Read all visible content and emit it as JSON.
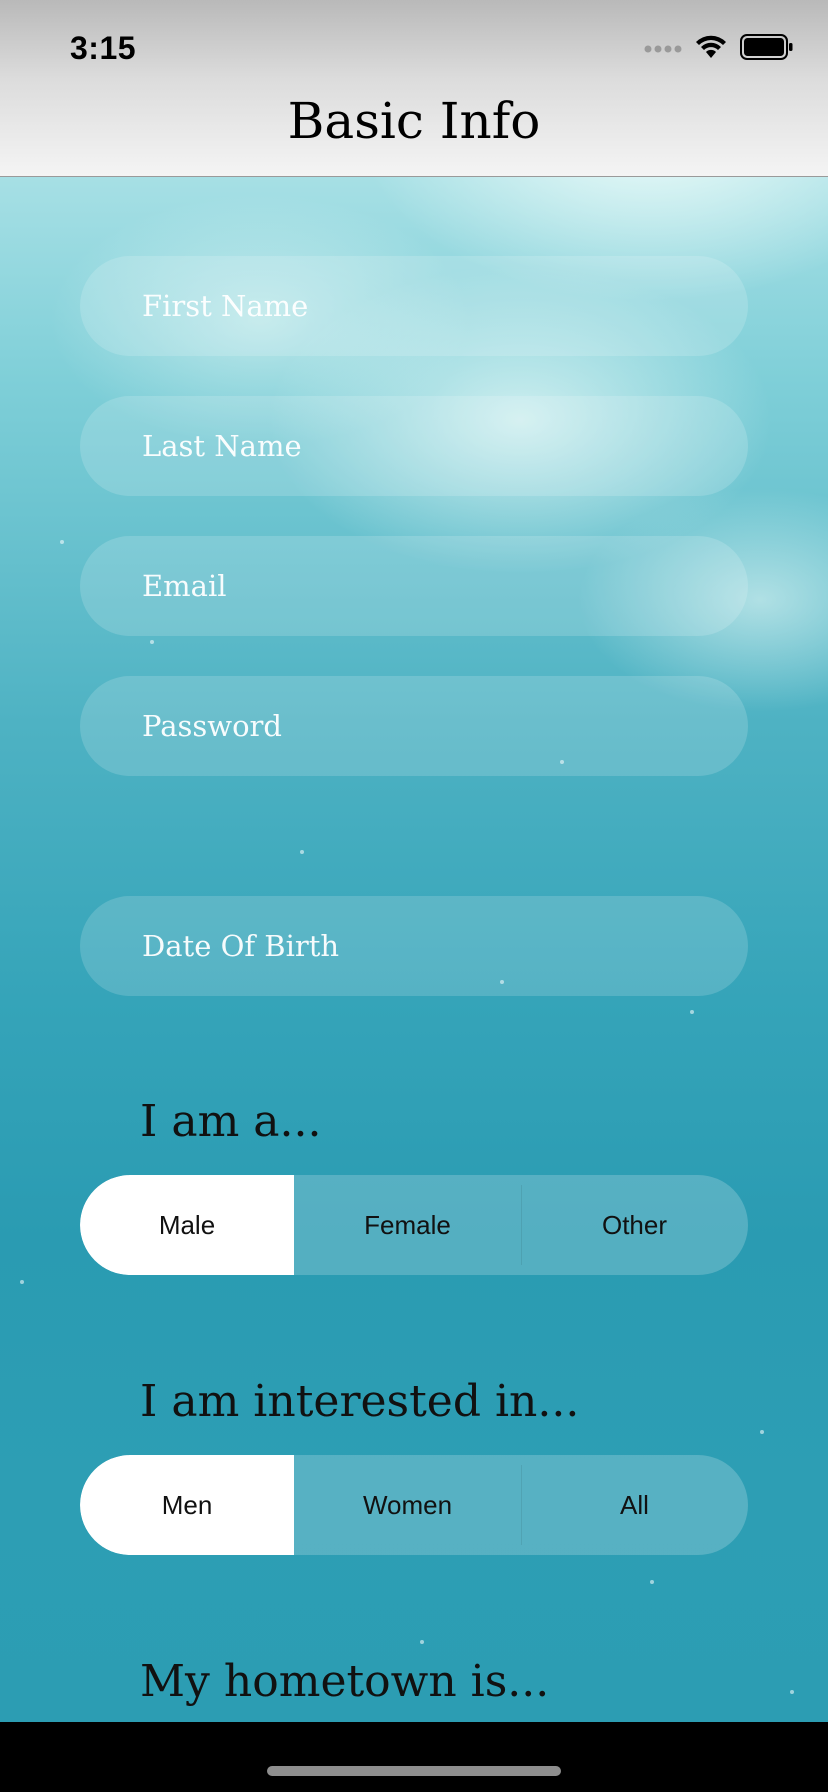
{
  "status_bar": {
    "time": "3:15",
    "icons": [
      "signal-icon",
      "wifi-icon",
      "battery-icon"
    ]
  },
  "nav": {
    "title": "Basic Info"
  },
  "form": {
    "first_name": {
      "placeholder": "First Name",
      "value": ""
    },
    "last_name": {
      "placeholder": "Last Name",
      "value": ""
    },
    "email": {
      "placeholder": "Email",
      "value": ""
    },
    "password": {
      "placeholder": "Password",
      "value": ""
    },
    "date_of_birth": {
      "placeholder": "Date Of Birth",
      "value": ""
    }
  },
  "gender": {
    "heading": "I am a...",
    "options": [
      "Male",
      "Female",
      "Other"
    ],
    "selected": "Male"
  },
  "interest": {
    "heading": "I am interested in...",
    "options": [
      "Men",
      "Women",
      "All"
    ],
    "selected": "Men"
  },
  "hometown": {
    "heading": "My hometown is..."
  },
  "colors": {
    "selected_segment": "#ffffff",
    "field_text": "#ffffff",
    "background_teal": "#2c9db3"
  }
}
